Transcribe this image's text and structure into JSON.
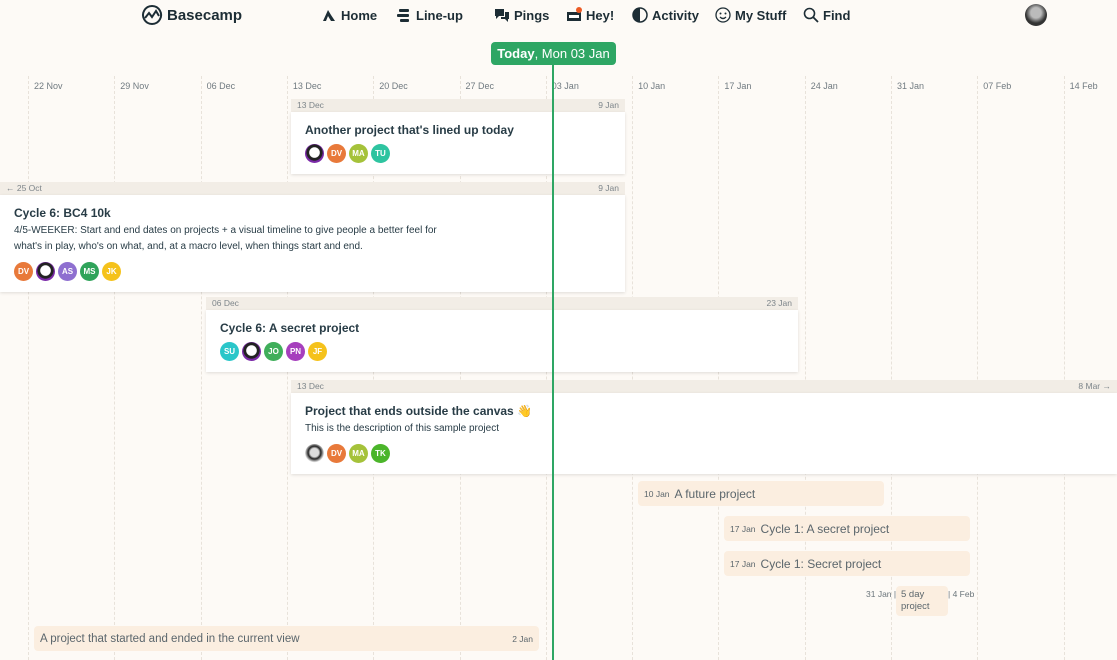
{
  "nav": {
    "brand": "Basecamp",
    "items": [
      {
        "label": "Home",
        "icon": "home-icon"
      },
      {
        "label": "Line-up",
        "icon": "lineup-icon"
      },
      {
        "label": "Pings",
        "icon": "pings-icon"
      },
      {
        "label": "Hey!",
        "icon": "hey-icon"
      },
      {
        "label": "Activity",
        "icon": "activity-icon"
      },
      {
        "label": "My Stuff",
        "icon": "smiley-icon"
      },
      {
        "label": "Find",
        "icon": "search-icon"
      }
    ]
  },
  "today": {
    "bold": "Today",
    "rest": ", Mon 03 Jan",
    "color": "#2ea664"
  },
  "ticks": [
    "22 Nov",
    "29 Nov",
    "06 Dec",
    "13 Dec",
    "20 Dec",
    "27 Dec",
    "03 Jan",
    "10 Jan",
    "17 Jan",
    "24 Jan",
    "31 Jan",
    "07 Feb",
    "14 Feb"
  ],
  "projects": [
    {
      "start": "13 Dec",
      "end": "9 Jan",
      "title": "Another project that's lined up today",
      "description": "",
      "avatars": [
        {
          "i": "",
          "c": "photo"
        },
        {
          "i": "DV",
          "c": "#e8793a"
        },
        {
          "i": "MA",
          "c": "#a5c23a"
        },
        {
          "i": "TU",
          "c": "#2ec4a0"
        }
      ]
    },
    {
      "start": "← 25 Oct",
      "end": "9 Jan",
      "title": "Cycle 6: BC4 10k",
      "description": "4/5-WEEKER: Start and end dates on projects + a visual timeline to give people a better feel for what's in play, who's on what, and, at a macro level, when things start and end.",
      "avatars": [
        {
          "i": "DV",
          "c": "#e8793a"
        },
        {
          "i": "",
          "c": "photo"
        },
        {
          "i": "AS",
          "c": "#8e6fd0"
        },
        {
          "i": "MS",
          "c": "#2fa35a"
        },
        {
          "i": "JK",
          "c": "#f5c21b"
        }
      ]
    },
    {
      "start": "06 Dec",
      "end": "23 Jan",
      "title": "Cycle 6: A secret project",
      "description": "",
      "avatars": [
        {
          "i": "SU",
          "c": "#2ac6c9"
        },
        {
          "i": "",
          "c": "photo"
        },
        {
          "i": "JO",
          "c": "#3fae5a"
        },
        {
          "i": "PN",
          "c": "#a63fbd"
        },
        {
          "i": "JF",
          "c": "#f5c21b"
        }
      ]
    },
    {
      "start": "13 Dec",
      "end": "8 Mar →",
      "title": "Project that ends outside the canvas 👋",
      "description": "This is the description of this sample project",
      "avatars": [
        {
          "i": "",
          "c": "photo2"
        },
        {
          "i": "DV",
          "c": "#e8793a"
        },
        {
          "i": "MA",
          "c": "#a5c23a"
        },
        {
          "i": "TK",
          "c": "#4bb52a"
        }
      ]
    }
  ],
  "future": [
    {
      "date": "10 Jan",
      "title": "A future project"
    },
    {
      "date": "17 Jan",
      "title": "Cycle 1: A secret project"
    },
    {
      "date": "17 Jan",
      "title": "Cycle 1: Secret project"
    }
  ],
  "short": {
    "start": "31 Jan |",
    "title": "5 day project",
    "end": "| 4 Feb"
  },
  "past": {
    "title": "A project that started and ended in the current view",
    "end": "2 Jan"
  }
}
